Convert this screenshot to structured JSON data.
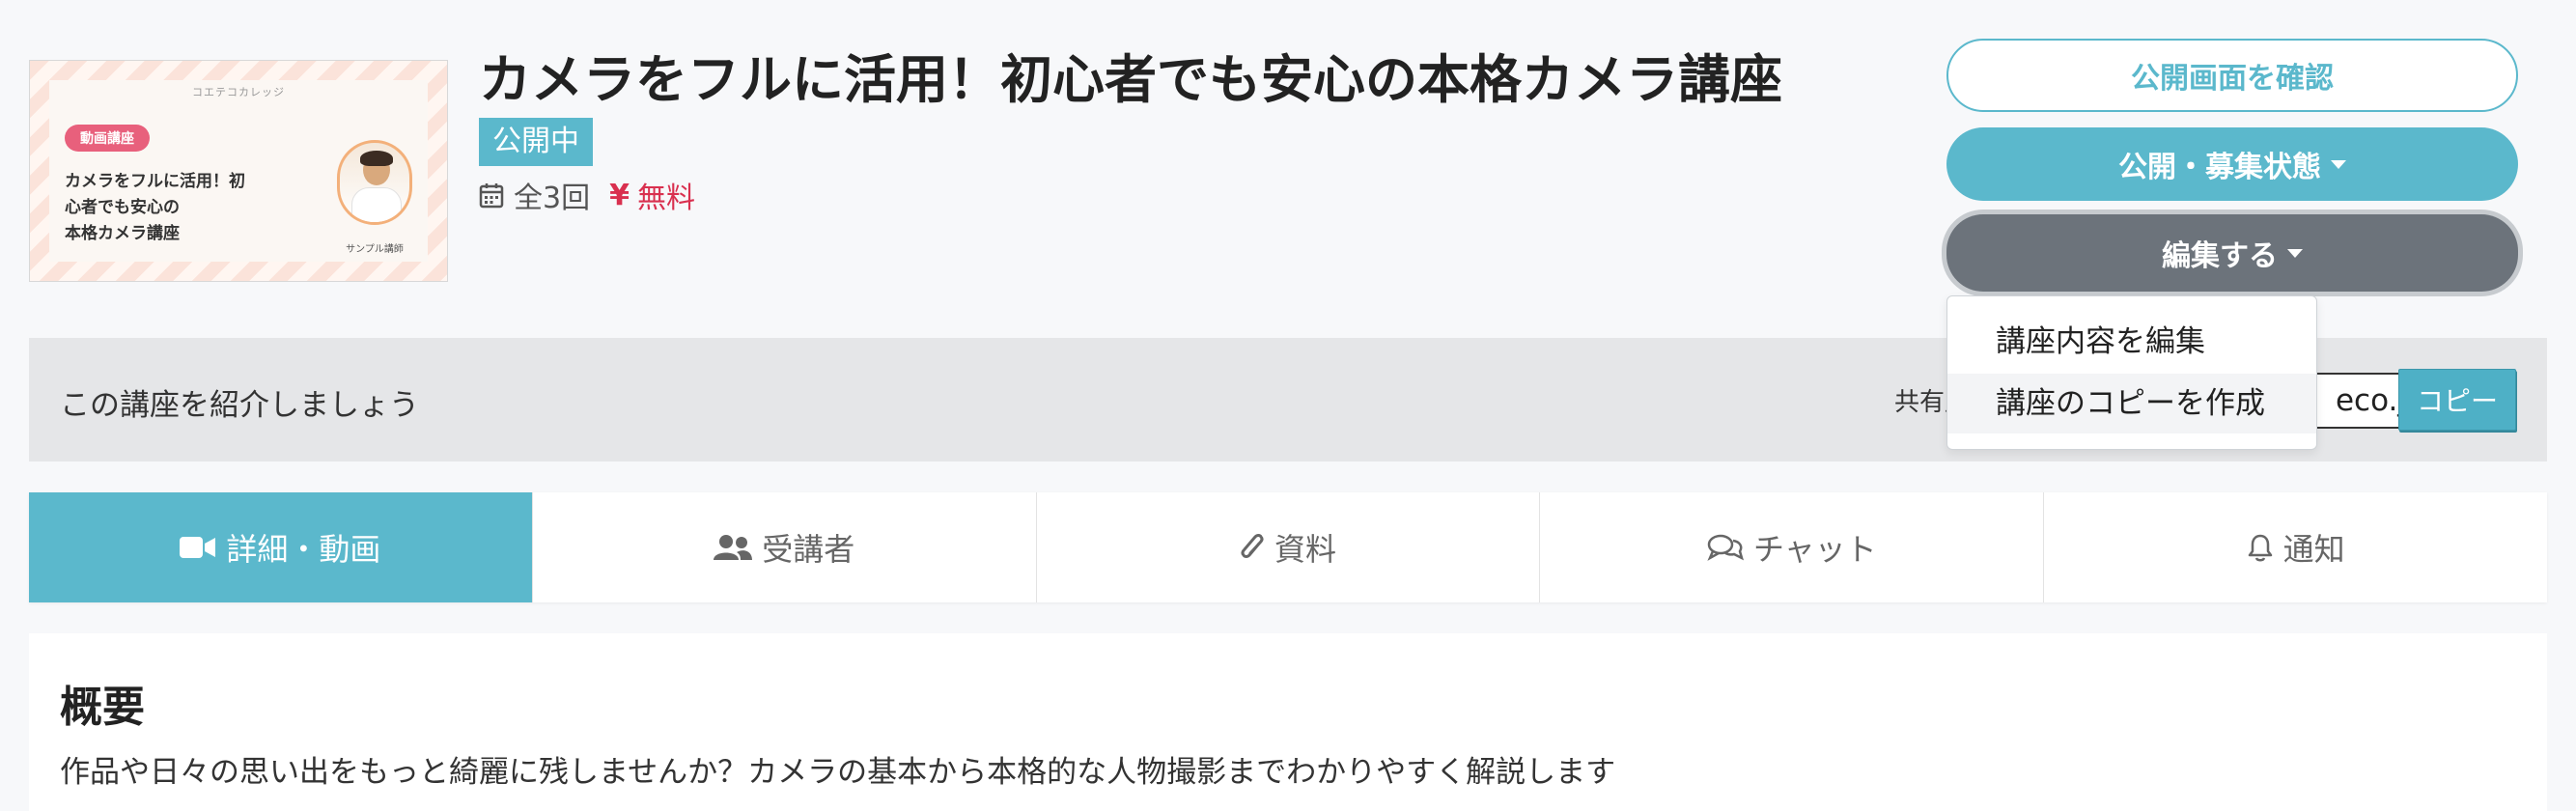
{
  "thumbnail": {
    "brand": "コエテコカレッジ",
    "badge": "動画講座",
    "title": "カメラをフルに活用！初\n心者でも安心の\n本格カメラ講座",
    "caption": "サンプル講師"
  },
  "course": {
    "title": "カメラをフルに活用！初心者でも安心の本格カメラ講座",
    "status": "公開中",
    "sessions": "全3回",
    "yen_symbol": "¥",
    "price": "無料"
  },
  "actions": {
    "view_public": "公開画面を確認",
    "publish_state": "公開・募集状態",
    "edit": "編集する"
  },
  "edit_menu": {
    "items": [
      "講座内容を編集",
      "講座のコピーを作成"
    ]
  },
  "promo": {
    "text": "この講座を紹介しましょう",
    "share_label": "共有用",
    "share_url_value": "eco.j",
    "copy_label": "コピー"
  },
  "tabs": [
    {
      "label": "詳細・動画",
      "icon": "video-icon",
      "active": true
    },
    {
      "label": "受講者",
      "icon": "users-icon",
      "active": false
    },
    {
      "label": "資料",
      "icon": "paperclip-icon",
      "active": false
    },
    {
      "label": "チャット",
      "icon": "chat-icon",
      "active": false
    },
    {
      "label": "通知",
      "icon": "bell-icon",
      "active": false
    }
  ],
  "overview": {
    "heading": "概要",
    "text": "作品や日々の思い出をもっと綺麗に残しませんか？カメラの基本から本格的な人物撮影までわかりやすく解説します"
  },
  "colors": {
    "accent": "#5bb8cc",
    "edit_button": "#6c737b",
    "price": "#d9304f",
    "badge_pink": "#e8607c"
  }
}
